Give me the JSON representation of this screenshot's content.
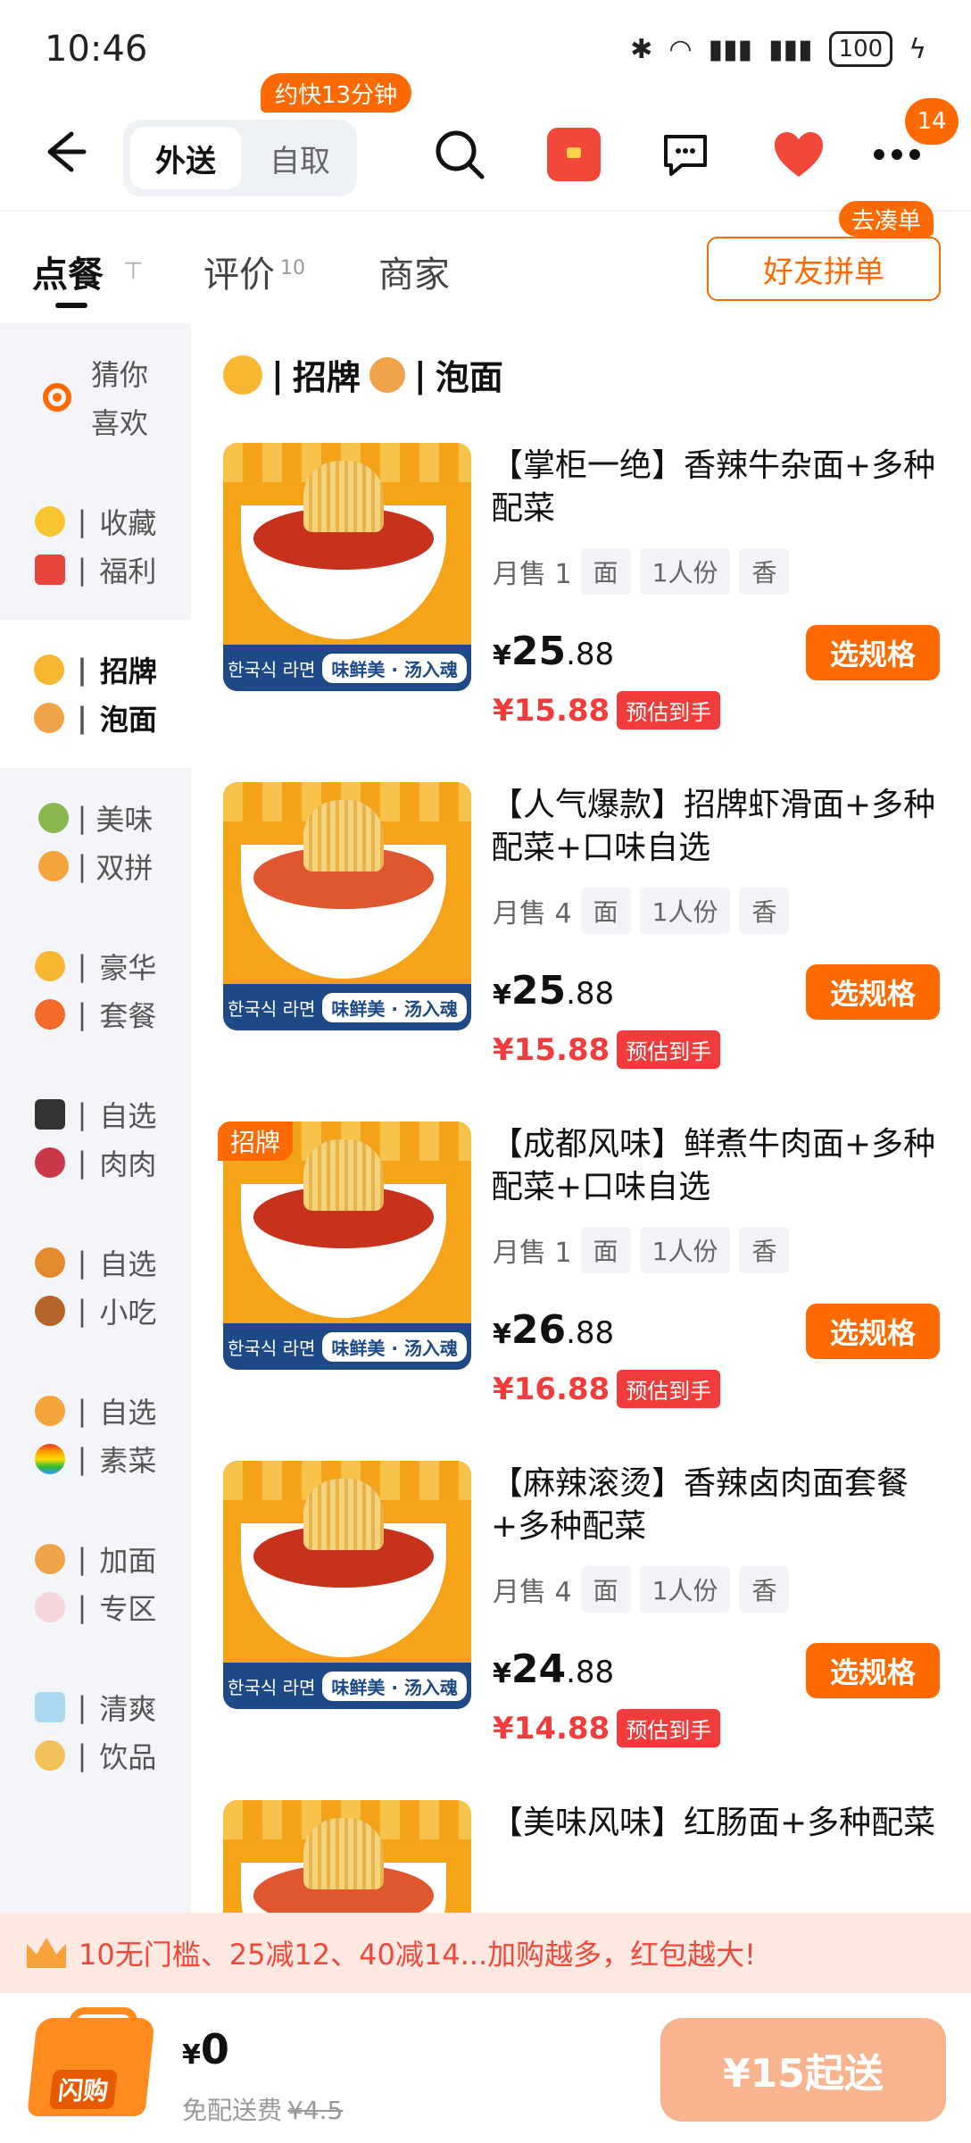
{
  "status_bar": {
    "time": "10:46",
    "battery": "100"
  },
  "nav": {
    "mode_active": "外送",
    "mode_other": "自取",
    "mode_tip": "约快13分钟",
    "more_badge": "14"
  },
  "tabs": {
    "order": "点餐",
    "reviews": "评价",
    "reviews_count": "10",
    "merchant": "商家",
    "friend_order": "好友拼单",
    "friend_tag": "去凑单"
  },
  "sidebar": {
    "items": [
      {
        "lines": [
          "猜你",
          "喜欢"
        ]
      },
      {
        "lines": [
          "收藏",
          "福利"
        ]
      },
      {
        "lines": [
          "招牌",
          "泡面"
        ]
      },
      {
        "lines": [
          "美味",
          "双拼"
        ]
      },
      {
        "lines": [
          "豪华",
          "套餐"
        ]
      },
      {
        "lines": [
          "自选",
          "肉肉"
        ]
      },
      {
        "lines": [
          "自选",
          "小吃"
        ]
      },
      {
        "lines": [
          "自选",
          "素菜"
        ]
      },
      {
        "lines": [
          "加面",
          "专区"
        ]
      },
      {
        "lines": [
          "清爽",
          "饮品"
        ]
      }
    ]
  },
  "section": {
    "title_a": "招牌",
    "title_b": "泡面"
  },
  "products": [
    {
      "title": "【掌柜一绝】香辣牛杂面+多种配菜",
      "sales": "月售 1",
      "tags": [
        "面",
        "1人份",
        "香"
      ],
      "price_int": "25",
      "price_dec": ".88",
      "deal_price": "¥15.88",
      "deal_label": "预估到手",
      "button": "选规格",
      "thumb_brand": "味鲜美 · 汤入魂",
      "thumb_side": "한국식 라면"
    },
    {
      "title": "【人气爆款】招牌虾滑面+多种配菜+口味自选",
      "sales": "月售 4",
      "tags": [
        "面",
        "1人份",
        "香"
      ],
      "price_int": "25",
      "price_dec": ".88",
      "deal_price": "¥15.88",
      "deal_label": "预估到手",
      "button": "选规格",
      "thumb_brand": "味鲜美 · 汤入魂",
      "thumb_side": "한국식 라면"
    },
    {
      "title": "【成都风味】鲜煮牛肉面+多种配菜+口味自选",
      "sales": "月售 1",
      "tags": [
        "面",
        "1人份",
        "香"
      ],
      "price_int": "26",
      "price_dec": ".88",
      "deal_price": "¥16.88",
      "deal_label": "预估到手",
      "button": "选规格",
      "badge": "招牌",
      "thumb_brand": "味鲜美 · 汤入魂",
      "thumb_side": "한국식 라면"
    },
    {
      "title": "【麻辣滚烫】香辣卤肉面套餐+多种配菜",
      "sales": "月售 4",
      "tags": [
        "面",
        "1人份",
        "香"
      ],
      "price_int": "24",
      "price_dec": ".88",
      "deal_price": "¥14.88",
      "deal_label": "预估到手",
      "button": "选规格",
      "thumb_brand": "味鲜美 · 汤入魂",
      "thumb_side": "한국식 라면"
    },
    {
      "title": "【美味风味】红肠面+多种配菜"
    }
  ],
  "currency": "¥",
  "promo": {
    "text": "10无门槛、25减12、40减14...加购越多，红包越大!"
  },
  "cart": {
    "bag_label": "闪购",
    "total": "0",
    "shipping": "免配送费",
    "shipping_orig": "¥4.5",
    "min_order": "¥15起送"
  },
  "colors": {
    "accent": "#ff6a00",
    "deal_red": "#f23c3c",
    "sidebar_bg": "#f4f5f9"
  }
}
